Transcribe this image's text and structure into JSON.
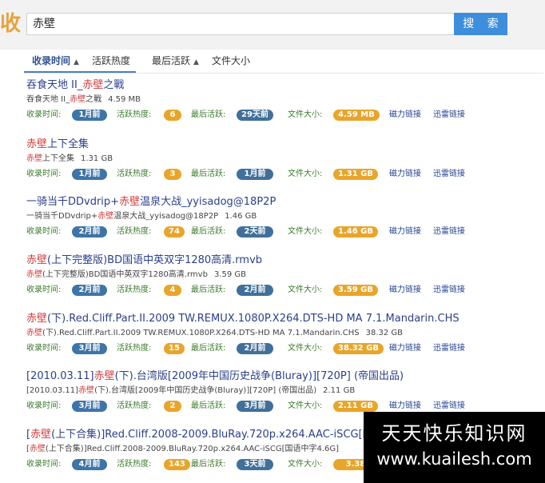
{
  "header": {
    "logo_fragment": "收",
    "search_value": "赤壁",
    "search_button": "搜 索"
  },
  "sortbar": {
    "items": [
      {
        "label": "收录时间",
        "arrow": "▲"
      },
      {
        "label": "活跃热度"
      },
      {
        "label": "最后活跃",
        "arrow": "▲"
      },
      {
        "label": "文件大小"
      }
    ]
  },
  "labels": {
    "collected": "收录时间:",
    "hotness": "活跃热度:",
    "last_active": "最后活跃:",
    "file_size": "文件大小:",
    "magnet": "磁力链接",
    "thunder": "迅雷链接"
  },
  "results": [
    {
      "title_pre": "吞食天地 II_",
      "title_hl": "赤壁",
      "title_post": "之戰",
      "sub_pre": "吞食天地 II_",
      "sub_hl": "赤壁",
      "sub_post": "之戰",
      "size_text": "4.59 MB",
      "collected": "1月前",
      "hotness": "6",
      "last_active": "29天前",
      "file_size": "4.59 MB"
    },
    {
      "title_pre": "",
      "title_hl": "赤壁",
      "title_post": "上下全集",
      "sub_pre": "",
      "sub_hl": "赤壁",
      "sub_post": "上下全集",
      "size_text": "1.31 GB",
      "collected": "1月前",
      "hotness": "3",
      "last_active": "1月前",
      "file_size": "1.31 GB"
    },
    {
      "title_pre": "一骑当千DDvdrip+",
      "title_hl": "赤壁",
      "title_post": "温泉大战_yyisadog@18P2P",
      "sub_pre": "一骑当千DDvdrip+",
      "sub_hl": "赤壁",
      "sub_post": "温泉大战_yyisadog@18P2P",
      "size_text": "1.46 GB",
      "collected": "2月前",
      "hotness": "74",
      "last_active": "2天前",
      "file_size": "1.46 GB"
    },
    {
      "title_pre": "",
      "title_hl": "赤壁",
      "title_post": "(上下完整版)BD国语中英双字1280高清.rmvb",
      "sub_pre": "",
      "sub_hl": "赤壁",
      "sub_post": "(上下完整版)BD国语中英双字1280高清.rmvb",
      "size_text": "3.59 GB",
      "collected": "2月前",
      "hotness": "4",
      "last_active": "2月前",
      "file_size": "3.59 GB"
    },
    {
      "title_pre": "",
      "title_hl": "赤壁",
      "title_post": "(下).Red.Cliff.Part.II.2009 TW.REMUX.1080P.X264.DTS-HD MA 7.1.Mandarin.CHS",
      "sub_pre": "",
      "sub_hl": "赤壁",
      "sub_post": "(下).Red.Cliff.Part.II.2009 TW.REMUX.1080P.X264.DTS-HD MA 7.1.Mandarin.CHS",
      "size_text": "38.32 GB",
      "collected": "3月前",
      "hotness": "15",
      "last_active": "2月前",
      "file_size": "38.32 GB"
    },
    {
      "title_pre": "[2010.03.11]",
      "title_hl": "赤壁",
      "title_post": "(下).台湾版[2009年中国历史战争(Bluray)][720P] (帝国出品)",
      "sub_pre": "[2010.03.11]",
      "sub_hl": "赤壁",
      "sub_post": "(下).台湾版[2009年中国历史战争(Bluray)][720P] (帝国出品)",
      "size_text": "2.11 GB",
      "collected": "3月前",
      "hotness": "2",
      "last_active": "3月前",
      "file_size": "2.11 GB"
    },
    {
      "title_pre": "[",
      "title_hl": "赤壁",
      "title_post": "(上下合集)]Red.Cliff.2008-2009.BluRay.720p.x264.AAC-iSCG[国",
      "sub_pre": "[",
      "sub_hl": "赤壁",
      "sub_post": "(上下合集)]Red.Cliff.2008-2009.BluRay.720p.x264.AAC-iSCG[国语中字4.6G]",
      "size_text": "",
      "collected": "4月前",
      "hotness": "143",
      "last_active": "3天前",
      "file_size": "3.38"
    }
  ],
  "watermark": {
    "line1": "天天快乐知识网",
    "line2": "www.kuailesh.com"
  }
}
